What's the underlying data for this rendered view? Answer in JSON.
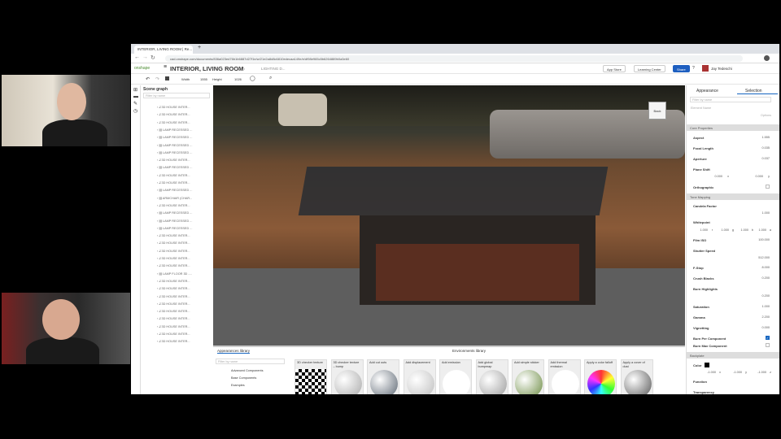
{
  "browser": {
    "tab_title": "INTERIOR, LIVING ROOM | Re...",
    "url": "cad.onshape.com/documents/836a023ed76b1b6887d27f1e/w/21e2a8d8c6810edecaa149e/e/df98e965c5b6264889b0a3e60"
  },
  "app": {
    "logo": "onshape",
    "title": "INTERIOR, LIVING ROOM",
    "branch": "Main",
    "breadcrumb": "LIGHTING D...",
    "app_store": "App Store",
    "learning_center": "Learning Center",
    "share": "Share",
    "user": "Jay Tedeschi"
  },
  "toolbar": {
    "width_label": "Width",
    "width_value": "1555",
    "height_label": "Height",
    "height_value": "1026"
  },
  "scene_graph": {
    "title": "Scene graph",
    "filter_placeholder": "Filter by name",
    "items": [
      "3D HOUSE INTER...",
      "3D HOUSE INTER...",
      "3D HOUSE INTER...",
      "LAMP RECESSED ...",
      "LAMP RECESSED ...",
      "LAMP RECESSED ...",
      "LAMP RECESSED ...",
      "3D HOUSE INTER...",
      "LAMP RECESSED ...",
      "3D HOUSE INTER...",
      "3D HOUSE INTER...",
      "LAMP RECESSED ...",
      "ARMCHAIR (CHAR...",
      "3D HOUSE INTER...",
      "LAMP RECESSED ...",
      "LAMP RECESSED ...",
      "LAMP RECESSED ...",
      "3D HOUSE INTER...",
      "3D HOUSE INTER...",
      "3D HOUSE INTER...",
      "3D HOUSE INTER...",
      "3D HOUSE INTER...",
      "LAMP FLOOR 3D -...",
      "3D HOUSE INTER...",
      "3D HOUSE INTER...",
      "3D HOUSE INTER...",
      "3D HOUSE INTER...",
      "3D HOUSE INTER...",
      "3D HOUSE INTER...",
      "3D HOUSE INTER...",
      "3D HOUSE INTER...",
      "3D HOUSE INTER...",
      "3D HOUSE INTER...",
      "3D HOUSE INTER...",
      "3D HOUSE INTER..."
    ],
    "camera": "Camera",
    "camera_settings": "Camera settings"
  },
  "viewcube": {
    "face": "Back"
  },
  "library": {
    "tab_appearances": "Appearances library",
    "tab_environments": "Environments library",
    "filter_placeholder": "Filter by name",
    "folders": [
      "Advanced Components",
      "Base Components",
      "Examples"
    ],
    "items": [
      {
        "label": "3D checker texture",
        "color": "checker"
      },
      {
        "label": "3D checker texture – bump",
        "color": "#a8a8a8"
      },
      {
        "label": "Add cut outs",
        "color": "#5a6470"
      },
      {
        "label": "Add displacement",
        "color": "#bdbdbd"
      },
      {
        "label": "Add emission",
        "color": "#ffffff"
      },
      {
        "label": "Add global bumpmap",
        "color": "#9a9a9a"
      },
      {
        "label": "Add simple sticker",
        "color": "#6a8a40"
      },
      {
        "label": "Add thermal emission",
        "color": "#ffffff"
      },
      {
        "label": "Apply a color falloff",
        "color": "#5a40c0"
      },
      {
        "label": "Apply a cover of dust",
        "color": "#555555"
      }
    ]
  },
  "right_panel": {
    "tab_appearance": "Appearance",
    "tab_selection": "Selection",
    "filter_placeholder": "Filter by name",
    "element_name": "Element Name",
    "options": "Options",
    "core": {
      "title": "Core Properties",
      "aspect": [
        "Aspect",
        "1.555"
      ],
      "focal": [
        "Focal Length",
        "0.035"
      ],
      "aperture": [
        "Aperture",
        "0.037"
      ],
      "plane_shift": "Plane Shift",
      "shift_x": "0.000",
      "shift_y": "0.000",
      "shift_x_axis": "x",
      "shift_y_axis": "y",
      "ortho": "Orthographic"
    },
    "tone": {
      "title": "Tone Mapping",
      "candela": [
        "Candela Factor",
        "1.000"
      ],
      "whitepoint": "Whitepoint",
      "wp": [
        "1.000",
        "1.000",
        "1.000",
        "1.000"
      ],
      "wp_axes": [
        "r",
        "g",
        "b",
        "a"
      ],
      "film_iso": [
        "Film ISO",
        "100.000"
      ],
      "shutter": [
        "Shutter Speed",
        "512.000"
      ],
      "fstop": [
        "F-Stop",
        "8.000"
      ],
      "crush": [
        "Crush Blacks",
        "0.200"
      ],
      "burn": [
        "Burn Highlights",
        "0.200"
      ],
      "saturation": [
        "Saturation",
        "1.000"
      ],
      "gamma": [
        "Gamma",
        "2.200"
      ],
      "vignetting": [
        "Vignetting",
        "0.000"
      ],
      "burn_per": "Burn Per Component",
      "burn_max": "Burn Max Component",
      "burn_per_checked": true,
      "burn_max_checked": false
    },
    "backplate": {
      "title": "Backplate",
      "color": "Color",
      "color_value": "#000000",
      "xyz": [
        "-1.000",
        "-1.000",
        "-1.000"
      ],
      "xyz_axes": [
        "x",
        "y",
        "z"
      ],
      "function": "Function",
      "transparency": "Transparency"
    }
  },
  "colors": {
    "accent": "#1565c0",
    "share": "#1e5fc0"
  }
}
